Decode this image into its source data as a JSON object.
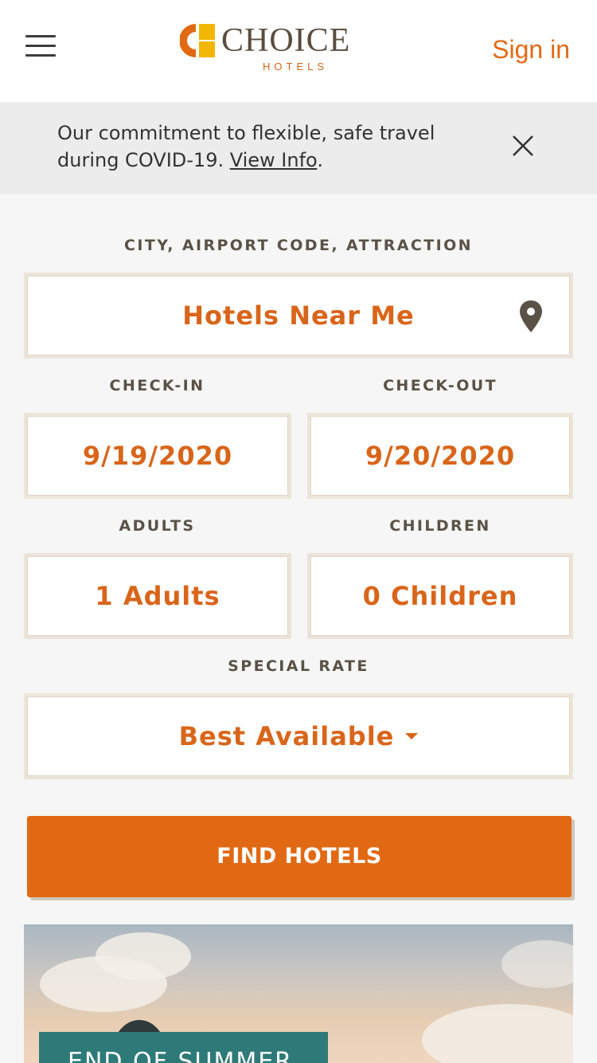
{
  "header": {
    "logo_word": "CHOICE",
    "logo_sub": "HOTELS",
    "logo_mark": "R",
    "sign_in": "Sign in"
  },
  "banner": {
    "text": "Our commitment to flexible, safe travel during COVID-19. ",
    "link": "View Info",
    "suffix": "."
  },
  "search": {
    "destination_label": "CITY, AIRPORT CODE, ATTRACTION",
    "destination_value": "Hotels Near Me",
    "checkin_label": "CHECK-IN",
    "checkin_value": "9/19/2020",
    "checkout_label": "CHECK-OUT",
    "checkout_value": "9/20/2020",
    "adults_label": "ADULTS",
    "adults_value": "1 Adults",
    "children_label": "CHILDREN",
    "children_value": "0 Children",
    "rate_label": "SPECIAL RATE",
    "rate_value": "Best Available",
    "find_button": "FIND HOTELS"
  },
  "promo": {
    "tag": "END OF SUMMER"
  },
  "colors": {
    "accent": "#e26914",
    "value_text": "#d9651a",
    "label_text": "#5a5247",
    "promo_tag": "#2d7a78"
  },
  "icons": [
    "menu-icon",
    "close-icon",
    "location-pin-icon",
    "caret-down-icon"
  ]
}
